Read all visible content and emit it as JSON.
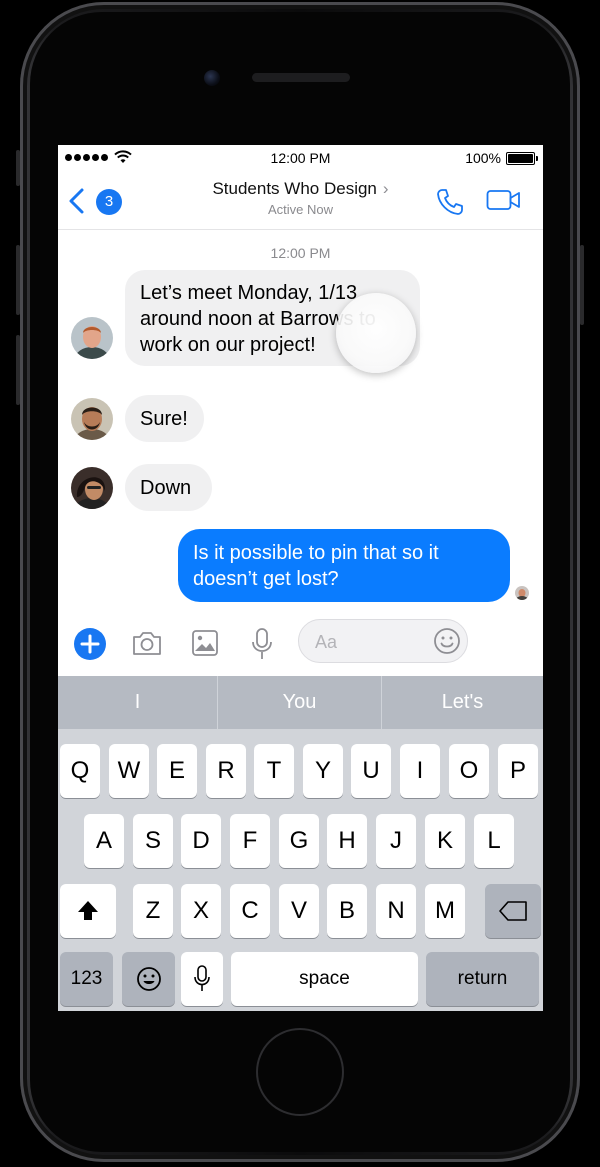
{
  "status_bar": {
    "time": "12:00 PM",
    "battery": "100%"
  },
  "nav": {
    "unread_count": "3",
    "title": "Students Who Design",
    "chevron": "›",
    "subtitle": "Active Now"
  },
  "timestamp": "12:00 PM",
  "messages": [
    {
      "from": "other",
      "text": "Let’s meet Monday, 1/13\naround noon at Barrows to\nwork on our project!"
    },
    {
      "from": "other",
      "text": "Sure!"
    },
    {
      "from": "other",
      "text": "Down"
    },
    {
      "from": "me",
      "text": "Is it possible to pin that so it\ndoesn’t get lost?"
    }
  ],
  "composer": {
    "placeholder": "Aa"
  },
  "keyboard": {
    "suggestions": [
      "I",
      "You",
      "Let's"
    ],
    "row1": [
      "Q",
      "W",
      "E",
      "R",
      "T",
      "Y",
      "U",
      "I",
      "O",
      "P"
    ],
    "row2": [
      "A",
      "S",
      "D",
      "F",
      "G",
      "H",
      "J",
      "K",
      "L"
    ],
    "row3": [
      "Z",
      "X",
      "C",
      "V",
      "B",
      "N",
      "M"
    ],
    "numbers_label": "123",
    "space_label": "space",
    "return_label": "return"
  },
  "colors": {
    "accent": "#1877f2",
    "outgoing_bubble": "#0a7cff",
    "incoming_bubble": "#f0f0f1",
    "keyboard_bg": "#d1d4d9"
  }
}
